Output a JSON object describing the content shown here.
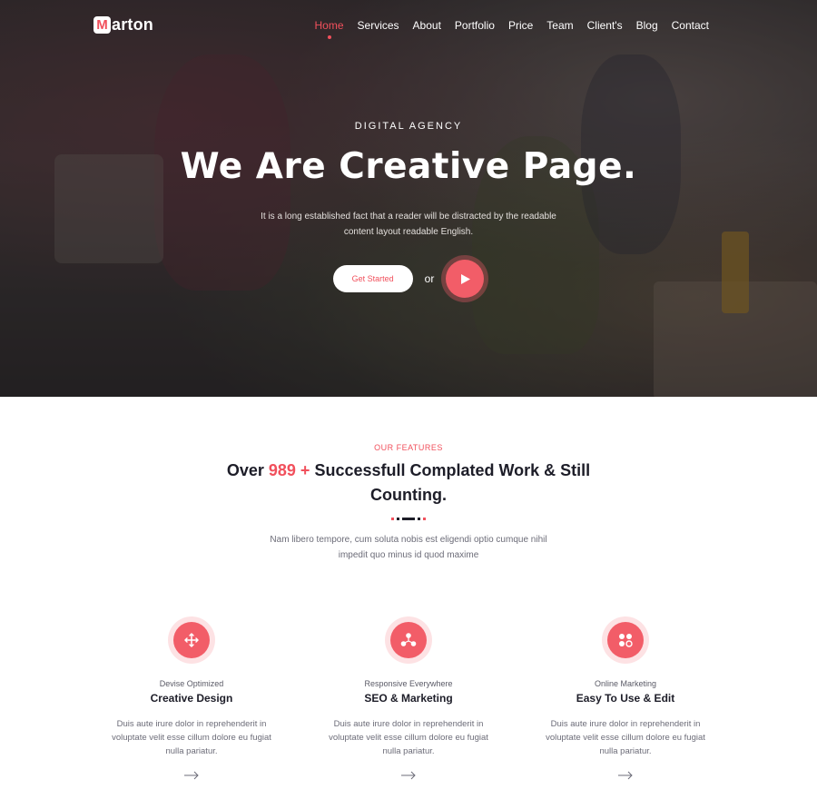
{
  "brand": {
    "logo_letter": "M",
    "logo_rest": "arton"
  },
  "nav": {
    "items": [
      "Home",
      "Services",
      "About",
      "Portfolio",
      "Price",
      "Team",
      "Client's",
      "Blog",
      "Contact"
    ],
    "active": "Home"
  },
  "hero": {
    "eyebrow": "DIGITAL AGENCY",
    "title": "We Are Creative Page.",
    "description": "It is a long established fact that a reader will be distracted by the readable content layout readable English.",
    "cta_label": "Get Started",
    "or_text": "or",
    "play_icon": "play-icon"
  },
  "features": {
    "eyebrow": "OUR FEATURES",
    "title_prefix": "Over",
    "title_number": "989 +",
    "title_suffix": "Successfull Complated Work & Still Counting.",
    "description": "Nam libero tempore, cum soluta nobis est eligendi optio cumque nihil impedit quo minus id quod maxime",
    "cards": [
      {
        "icon": "move-arrows-icon",
        "subtitle": "Devise Optimized",
        "title": "Creative Design",
        "text": "Duis aute irure dolor in reprehenderit in voluptate velit esse cillum dolore eu fugiat nulla pariatur."
      },
      {
        "icon": "network-nodes-icon",
        "subtitle": "Responsive Everywhere",
        "title": "SEO & Marketing",
        "text": "Duis aute irure dolor in reprehenderit in voluptate velit esse cillum dolore eu fugiat nulla pariatur."
      },
      {
        "icon": "apps-grid-icon",
        "subtitle": "Online Marketing",
        "title": "Easy To Use & Edit",
        "text": "Duis aute irure dolor in reprehenderit in voluptate velit esse cillum dolore eu fugiat nulla pariatur."
      }
    ]
  },
  "colors": {
    "accent": "#f1505c",
    "dark": "#1d1d28",
    "muted": "#6c6c78"
  }
}
